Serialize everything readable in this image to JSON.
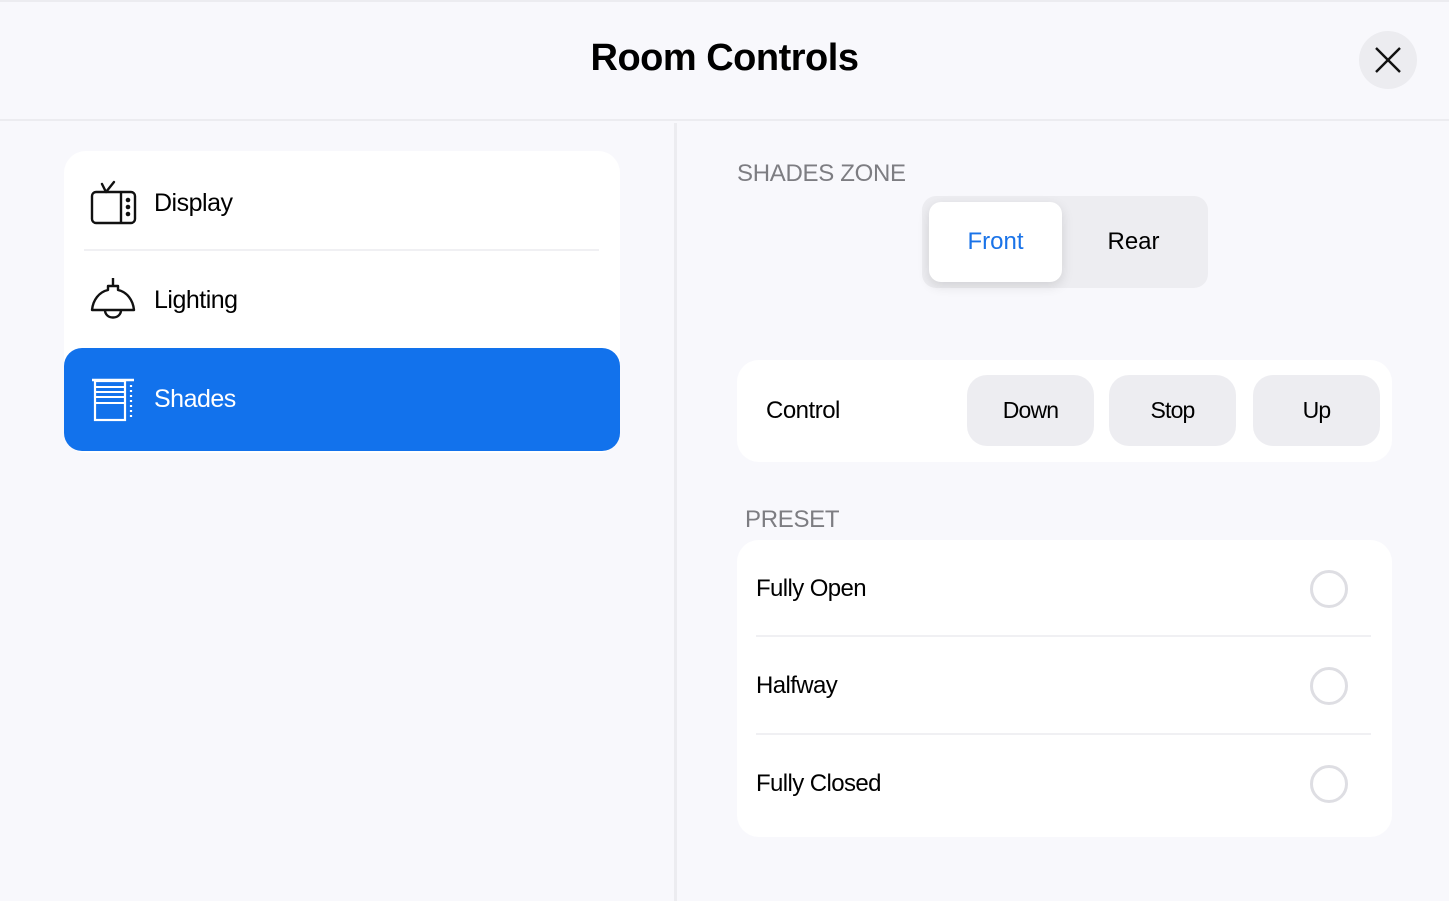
{
  "header": {
    "title": "Room Controls",
    "close_icon": "close-icon"
  },
  "sidebar": {
    "active_color": "#1272ec",
    "items": [
      {
        "label": "Display",
        "icon": "tv-icon",
        "active": false
      },
      {
        "label": "Lighting",
        "icon": "pendant-lamp-icon",
        "active": false
      },
      {
        "label": "Shades",
        "icon": "window-shade-icon",
        "active": true
      }
    ]
  },
  "main": {
    "zone": {
      "label": "SHADES ZONE",
      "options": [
        "Front",
        "Rear"
      ],
      "selected": "Front",
      "selected_color": "#1a73e8"
    },
    "control": {
      "label": "Control",
      "buttons": [
        "Down",
        "Stop",
        "Up"
      ]
    },
    "preset": {
      "label": "PRESET",
      "options": [
        {
          "label": "Fully Open",
          "selected": false
        },
        {
          "label": "Halfway",
          "selected": false
        },
        {
          "label": "Fully Closed",
          "selected": false
        }
      ]
    }
  }
}
